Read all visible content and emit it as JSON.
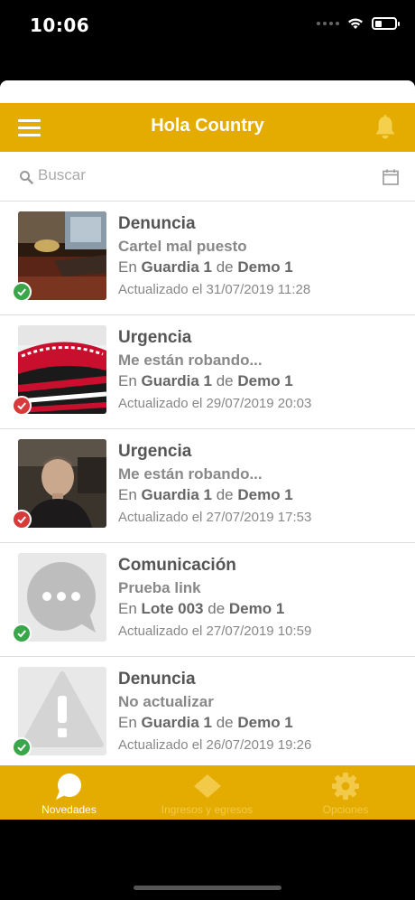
{
  "status": {
    "time": "10:06"
  },
  "header": {
    "title": "Hola Country"
  },
  "search": {
    "placeholder": "Buscar"
  },
  "items": [
    {
      "type": "Denuncia",
      "subtitle": "Cartel mal puesto",
      "prefix": "En",
      "place": "Guardia 1",
      "de": "de",
      "site": "Demo 1",
      "updated": "Actualizado el 31/07/2019 11:28",
      "status": "green"
    },
    {
      "type": "Urgencia",
      "subtitle": "Me están robando...",
      "prefix": "En",
      "place": "Guardia 1",
      "de": "de",
      "site": "Demo 1",
      "updated": "Actualizado el 29/07/2019 20:03",
      "status": "red"
    },
    {
      "type": "Urgencia",
      "subtitle": "Me están robando...",
      "prefix": "En",
      "place": "Guardia 1",
      "de": "de",
      "site": "Demo 1",
      "updated": "Actualizado el 27/07/2019 17:53",
      "status": "red"
    },
    {
      "type": "Comunicación",
      "subtitle": "Prueba link",
      "prefix": "En",
      "place": "Lote 003",
      "de": "de",
      "site": "Demo 1",
      "updated": "Actualizado el 27/07/2019 10:59",
      "status": "green"
    },
    {
      "type": "Denuncia",
      "subtitle": "No actualizar",
      "prefix": "En",
      "place": "Guardia 1",
      "de": "de",
      "site": "Demo 1",
      "updated": "Actualizado el 26/07/2019 19:26",
      "status": "green"
    }
  ],
  "tabs": [
    {
      "label": "Novedades",
      "icon": "chat-bubble-icon",
      "active": true
    },
    {
      "label": "Ingresos y egresos",
      "icon": "diamond-icon",
      "active": false
    },
    {
      "label": "Opciones",
      "icon": "gear-icon",
      "active": false
    }
  ],
  "colors": {
    "accent": "#e4ac00",
    "success": "#3aa64a",
    "danger": "#d83a3a"
  }
}
